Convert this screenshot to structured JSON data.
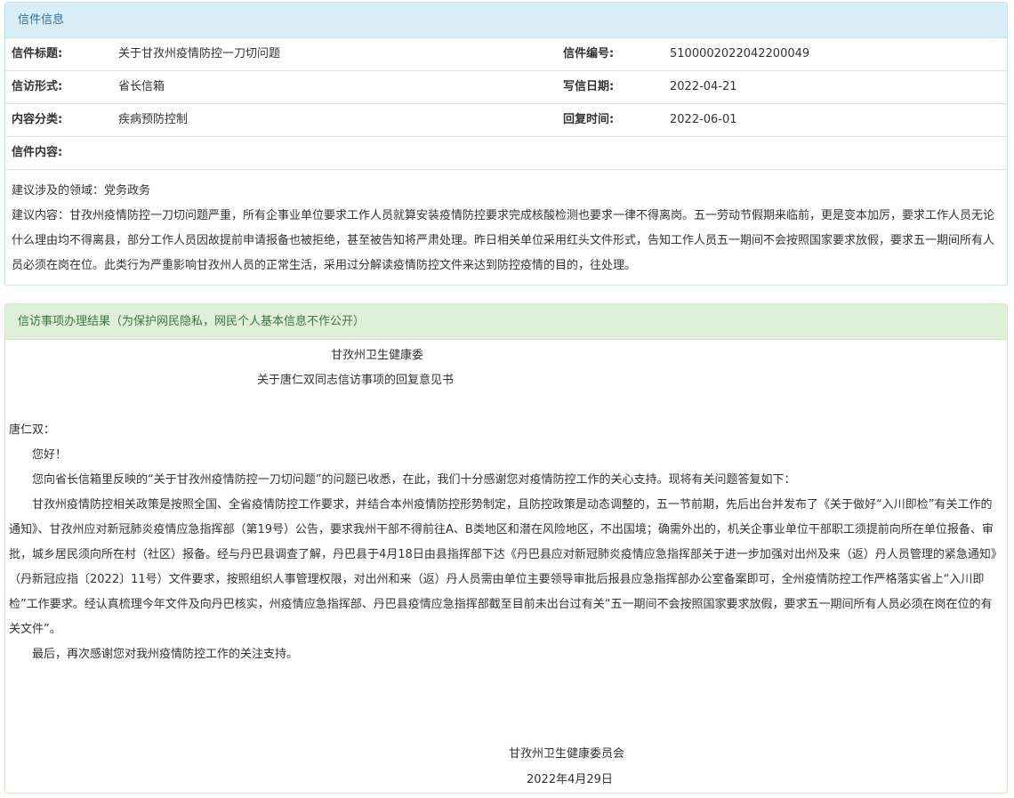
{
  "info_panel": {
    "title": "信件信息",
    "rows": [
      {
        "label1": "信件标题:",
        "value1": "关于甘孜州疫情防控一刀切问题",
        "label2": "信件编号:",
        "value2": "5100002022042200049"
      },
      {
        "label1": "信访形式:",
        "value1": "省长信箱",
        "label2": "写信日期:",
        "value2": "2022-04-21"
      },
      {
        "label1": "内容分类:",
        "value1": "疾病预防控制",
        "label2": "回复时间:",
        "value2": "2022-06-01"
      }
    ],
    "content_label": "信件内容:",
    "domain_line": "建议涉及的领域：党务政务",
    "content_text": "建议内容：甘孜州疫情防控一刀切问题严重，所有企事业单位要求工作人员就算安装疫情防控要求完成核酸检测也要求一律不得离岗。五一劳动节假期来临前，更是变本加厉，要求工作人员无论什么理由均不得离县，部分工作人员因故提前申请报备也被拒绝，甚至被告知将严肃处理。昨日相关单位采用红头文件形式，告知工作人员五一期间不会按照国家要求放假，要求五一期间所有人员必须在岗在位。此类行为严重影响甘孜州人员的正常生活，采用过分解读疫情防控文件来达到防控疫情的目的，往处理。"
  },
  "result_panel": {
    "title": "信访事项办理结果（为保护网民隐私，网民个人基本信息不作公开）",
    "org_line": "甘孜州卫生健康委",
    "doc_title": "关于唐仁双同志信访事项的回复意见书",
    "salutation": "唐仁双：",
    "greeting": "您好！",
    "para1": "您向省长信箱里反映的“关于甘孜州疫情防控一刀切问题”的问题已收悉，在此，我们十分感谢您对疫情防控工作的关心支持。现将有关问题答复如下：",
    "para2": "甘孜州疫情防控相关政策是按照全国、全省疫情防控工作要求，并结合本州疫情防控形势制定，且防控政策是动态调整的，五一节前期，先后出台并发布了《关于做好“入川即检”有关工作的通知》、甘孜州应对新冠肺炎疫情应急指挥部（第19号）公告，要求我州干部不得前往A、B类地区和潜在风险地区，不出国境；确需外出的，机关企事业单位干部职工须提前向所在单位报备、审批，城乡居民须向所在村（社区）报备。经与丹巴县调查了解，丹巴县于4月18日由县指挥部下达《丹巴县应对新冠肺炎疫情应急指挥部关于进一步加强对出州及来（返）丹人员管理的紧急通知》（丹新冠应指〔2022〕11号）文件要求，按照组织人事管理权限，对出州和来（返）丹人员需由单位主要领导审批后报县应急指挥部办公室备案即可，全州疫情防控工作严格落实省上“入川即检”工作要求。经认真梳理今年文件及向丹巴核实，州疫情应急指挥部、丹巴县疫情应急指挥部截至目前未出台过有关“五一期间不会按照国家要求放假，要求五一期间所有人员必须在岗在位的有关文件”。",
    "para3": "最后，再次感谢您对我州疫情防控工作的关注支持。",
    "sign_org": "甘孜州卫生健康委员会",
    "sign_date": "2022年4月29日"
  }
}
